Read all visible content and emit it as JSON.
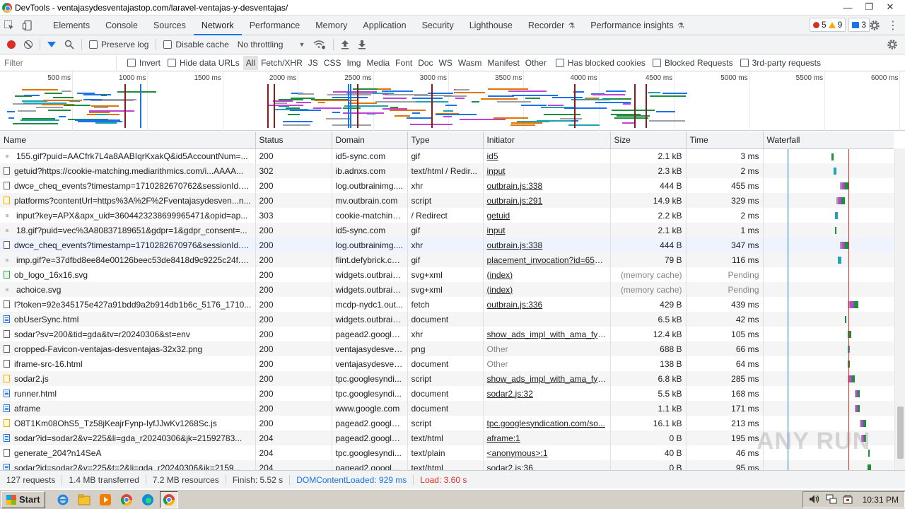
{
  "window": {
    "title": "DevTools - ventajasydesventajastop.com/laravel-ventajas-y-desventajas/",
    "minimize": "—",
    "maximize": "❐",
    "close": "✕"
  },
  "tabs": [
    {
      "label": "Elements"
    },
    {
      "label": "Console"
    },
    {
      "label": "Sources"
    },
    {
      "label": "Network",
      "active": true
    },
    {
      "label": "Performance"
    },
    {
      "label": "Memory"
    },
    {
      "label": "Application"
    },
    {
      "label": "Security"
    },
    {
      "label": "Lighthouse"
    },
    {
      "label": "Recorder",
      "flask": true
    },
    {
      "label": "Performance insights",
      "flask": true
    }
  ],
  "issues": {
    "errors": "5",
    "warnings": "9",
    "messages": "3"
  },
  "toolbar": {
    "preserve_log": "Preserve log",
    "disable_cache": "Disable cache",
    "throttling": "No throttling"
  },
  "filter": {
    "placeholder": "Filter",
    "invert": "Invert",
    "hide_data_urls": "Hide data URLs",
    "types": [
      "All",
      "Fetch/XHR",
      "JS",
      "CSS",
      "Img",
      "Media",
      "Font",
      "Doc",
      "WS",
      "Wasm",
      "Manifest",
      "Other"
    ],
    "has_blocked_cookies": "Has blocked cookies",
    "blocked_requests": "Blocked Requests",
    "third_party": "3rd-party requests"
  },
  "overview_ticks": [
    "500 ms",
    "1000 ms",
    "1500 ms",
    "2000 ms",
    "2500 ms",
    "3000 ms",
    "3500 ms",
    "4000 ms",
    "4500 ms",
    "5000 ms",
    "5500 ms",
    "6000 ms"
  ],
  "columns": [
    "Name",
    "Status",
    "Domain",
    "Type",
    "Initiator",
    "Size",
    "Time",
    "Waterfall"
  ],
  "rows": [
    {
      "icon": "dot",
      "name": "155.gif?puid=AACfrk7L4a8AABIqrKxakQ&id5AccountNum=...",
      "status": "200",
      "domain": "id5-sync.com",
      "type": "gif",
      "initiator": "id5",
      "init_link": true,
      "size": "2.1 kB",
      "time": "3 ms"
    },
    {
      "icon": "xhr",
      "name": "getuid?https://cookie-matching.mediarithmics.com/i...AAAA...",
      "status": "302",
      "domain": "ib.adnxs.com",
      "type": "text/html / Redir...",
      "initiator": "input",
      "init_link": true,
      "size": "2.3 kB",
      "time": "2 ms"
    },
    {
      "icon": "xhr",
      "name": "dwce_cheq_events?timestamp=1710282670762&sessionId......",
      "status": "200",
      "domain": "log.outbrainimg....",
      "type": "xhr",
      "initiator": "outbrain.js:338",
      "init_link": true,
      "size": "444 B",
      "time": "455 ms"
    },
    {
      "icon": "script",
      "name": "platforms?contentUrl=https%3A%2F%2Fventajasydesven...n...",
      "status": "200",
      "domain": "mv.outbrain.com",
      "type": "script",
      "initiator": "outbrain.js:291",
      "init_link": true,
      "size": "14.9 kB",
      "time": "329 ms"
    },
    {
      "icon": "dot",
      "name": "input?key=APX&apx_uid=3604423238699965471&opid=ap...",
      "status": "303",
      "domain": "cookie-matching...",
      "type": "/ Redirect",
      "initiator": "getuid",
      "init_link": true,
      "size": "2.2 kB",
      "time": "2 ms"
    },
    {
      "icon": "dot",
      "name": "18.gif?puid=vec%3A80837189651&gdpr=1&gdpr_consent=...",
      "status": "200",
      "domain": "id5-sync.com",
      "type": "gif",
      "initiator": "input",
      "init_link": true,
      "size": "2.1 kB",
      "time": "1 ms"
    },
    {
      "icon": "xhr",
      "name": "dwce_cheq_events?timestamp=1710282670976&sessionId......",
      "status": "200",
      "domain": "log.outbrainimg....",
      "type": "xhr",
      "initiator": "outbrain.js:338",
      "init_link": true,
      "size": "444 B",
      "time": "347 ms",
      "hl": true
    },
    {
      "icon": "dot",
      "name": "imp.gif?e=37dfbd8ee84e00126beec53de8418d9c9225c24f......",
      "status": "200",
      "domain": "flint.defybrick.com",
      "type": "gif",
      "initiator": "placement_invocation?id=653...",
      "init_link": true,
      "size": "79 B",
      "time": "116 ms"
    },
    {
      "icon": "img",
      "name": "ob_logo_16x16.svg",
      "status": "200",
      "domain": "widgets.outbrain....",
      "type": "svg+xml",
      "initiator": "(index)",
      "init_link": true,
      "size": "(memory cache)",
      "size_gray": true,
      "time": "Pending",
      "time_gray": true
    },
    {
      "icon": "dot",
      "name": "achoice.svg",
      "status": "200",
      "domain": "widgets.outbrain....",
      "type": "svg+xml",
      "initiator": "(index)",
      "init_link": true,
      "size": "(memory cache)",
      "size_gray": true,
      "time": "Pending",
      "time_gray": true
    },
    {
      "icon": "xhr",
      "name": "l?token=92e345175e427a91bdd9a2b914db1b6c_5176_1710...",
      "status": "200",
      "domain": "mcdp-nydc1.out...",
      "type": "fetch",
      "initiator": "outbrain.js:336",
      "init_link": true,
      "size": "429 B",
      "time": "439 ms"
    },
    {
      "icon": "doc",
      "name": "obUserSync.html",
      "status": "200",
      "domain": "widgets.outbrain....",
      "type": "document",
      "initiator": "",
      "size": "6.5 kB",
      "time": "42 ms"
    },
    {
      "icon": "xhr",
      "name": "sodar?sv=200&tid=gda&tv=r20240306&st=env",
      "status": "200",
      "domain": "pagead2.google...",
      "type": "xhr",
      "initiator": "show_ads_impl_with_ama_fy20...",
      "init_link": true,
      "size": "12.4 kB",
      "time": "105 ms"
    },
    {
      "icon": "xhr",
      "name": "cropped-Favicon-ventajas-desventajas-32x32.png",
      "status": "200",
      "domain": "ventajasydesven...",
      "type": "png",
      "initiator": "Other",
      "init_gray": true,
      "size": "688 B",
      "time": "66 ms"
    },
    {
      "icon": "xhr",
      "name": "iframe-src-16.html",
      "status": "200",
      "domain": "ventajasydesven...",
      "type": "document",
      "initiator": "Other",
      "init_gray": true,
      "size": "138 B",
      "time": "64 ms"
    },
    {
      "icon": "script",
      "name": "sodar2.js",
      "status": "200",
      "domain": "tpc.googlesyndi...",
      "type": "script",
      "initiator": "show_ads_impl_with_ama_fy20...",
      "init_link": true,
      "size": "6.8 kB",
      "time": "285 ms"
    },
    {
      "icon": "doc",
      "name": "runner.html",
      "status": "200",
      "domain": "tpc.googlesyndi...",
      "type": "document",
      "initiator": "sodar2.js:32",
      "init_link": true,
      "size": "5.5 kB",
      "time": "168 ms"
    },
    {
      "icon": "doc",
      "name": "aframe",
      "status": "200",
      "domain": "www.google.com",
      "type": "document",
      "initiator": "",
      "size": "1.1 kB",
      "time": "171 ms"
    },
    {
      "icon": "script",
      "name": "O8T1Km08OhS5_Tz58jKeajrFynp-IyfJJwKv1268Sc.js",
      "status": "200",
      "domain": "pagead2.google...",
      "type": "script",
      "initiator": "tpc.googlesyndication.com/so...",
      "init_link": true,
      "size": "16.1 kB",
      "time": "213 ms"
    },
    {
      "icon": "doc",
      "name": "sodar?id=sodar2&v=225&li=gda_r20240306&jk=21592783...",
      "status": "204",
      "domain": "pagead2.google...",
      "type": "text/html",
      "initiator": "aframe:1",
      "init_link": true,
      "size": "0 B",
      "time": "195 ms"
    },
    {
      "icon": "xhr",
      "name": "generate_204?n14SeA",
      "status": "204",
      "domain": "tpc.googlesyndi...",
      "type": "text/plain",
      "initiator": "<anonymous>:1",
      "init_link": true,
      "size": "40 B",
      "time": "46 ms"
    },
    {
      "icon": "doc",
      "name": "sodar?id=sodar2&v=225&t=2&li=gda_r20240306&jk=2159...",
      "status": "204",
      "domain": "pagead2.google...",
      "type": "text/html",
      "initiator": "sodar2.js:36",
      "init_link": true,
      "size": "0 B",
      "time": "95 ms"
    }
  ],
  "status_bar": {
    "requests": "127 requests",
    "transferred": "1.4 MB transferred",
    "resources": "7.2 MB resources",
    "finish": "Finish: 5.52 s",
    "dcl": "DOMContentLoaded: 929 ms",
    "load": "Load: 3.60 s"
  },
  "taskbar": {
    "start": "Start",
    "clock": "10:31 PM"
  },
  "watermark": "ANY RUN",
  "colors": {
    "accent": "#1a73e8",
    "error": "#d93025",
    "warning": "#f9ab00",
    "waterfall_green": "#1e8e3e",
    "waterfall_purple": "#c142d6",
    "waterfall_teal": "#1ea4b5"
  }
}
